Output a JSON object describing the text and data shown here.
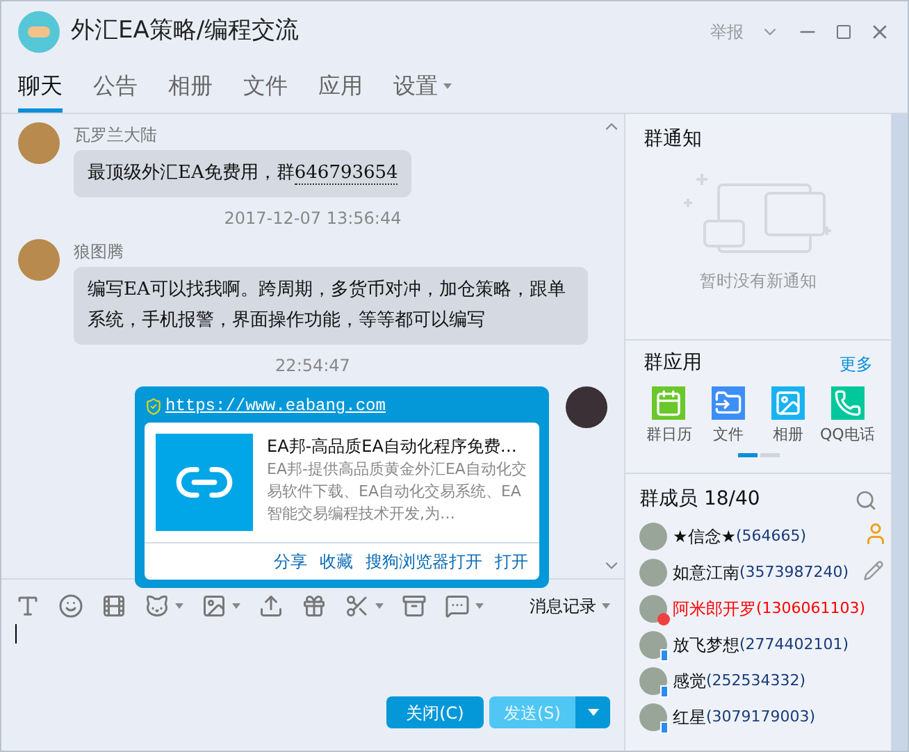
{
  "window": {
    "title": "外汇EA策略/编程交流",
    "report": "举报"
  },
  "tabs": [
    {
      "label": "聊天",
      "selected": true,
      "dropdown": false
    },
    {
      "label": "公告",
      "selected": false,
      "dropdown": false
    },
    {
      "label": "相册",
      "selected": false,
      "dropdown": false
    },
    {
      "label": "文件",
      "selected": false,
      "dropdown": false
    },
    {
      "label": "应用",
      "selected": false,
      "dropdown": false
    },
    {
      "label": "设置",
      "selected": false,
      "dropdown": true
    }
  ],
  "chat": {
    "messages": [
      {
        "kind": "incoming",
        "sender": "瓦罗兰大陆",
        "text": "最顶级外汇EA免费用，群",
        "link": "646793654"
      },
      {
        "kind": "time",
        "text": "2017-12-07 13:56:44"
      },
      {
        "kind": "incoming",
        "sender": "狼图腾",
        "text": "编写EA可以找我啊。跨周期，多货币对冲，加仓策略，跟单系统，手机报警，界面操作功能，等等都可以编写"
      },
      {
        "kind": "time",
        "text": "22:54:47"
      },
      {
        "kind": "card",
        "url": "https://www.eabang.com",
        "title": "EA邦-高品质EA自动化程序免费…",
        "description": "EA邦-提供高品质黄金外汇EA自动化交易软件下载、EA自动化交易系统、EA智能交易编程技术开发,为…",
        "actions": [
          "分享",
          "收藏",
          "搜狗浏览器打开",
          "打开"
        ]
      }
    ]
  },
  "input": {
    "history_label": "消息记录",
    "buttons": [
      {
        "label": "关闭(C)",
        "kind": "close"
      },
      {
        "label": "发送(S)",
        "kind": "send"
      }
    ]
  },
  "notice": {
    "title": "群通知",
    "empty": "暂时没有新通知"
  },
  "apps": {
    "title": "群应用",
    "more": "更多",
    "items": [
      {
        "label": "群日历",
        "kind": "calendar"
      },
      {
        "label": "文件",
        "kind": "file"
      },
      {
        "label": "相册",
        "kind": "album"
      },
      {
        "label": "QQ电话",
        "kind": "phone"
      }
    ]
  },
  "members": {
    "title": "群成员 18/40",
    "items": [
      {
        "name": "★信念★",
        "id": "(564665)",
        "kind": "plain"
      },
      {
        "name": "如意江南",
        "id": "(3573987240)",
        "kind": "plain"
      },
      {
        "name": "阿米郎开罗",
        "id": "(1306061103)",
        "kind": "blocked"
      },
      {
        "name": "放飞梦想",
        "id": "(2774402101)",
        "kind": "mobile"
      },
      {
        "name": "感觉",
        "id": "(252534332)",
        "kind": "mobile"
      },
      {
        "name": "红星",
        "id": "(3079179003)",
        "kind": "mobile"
      }
    ]
  }
}
